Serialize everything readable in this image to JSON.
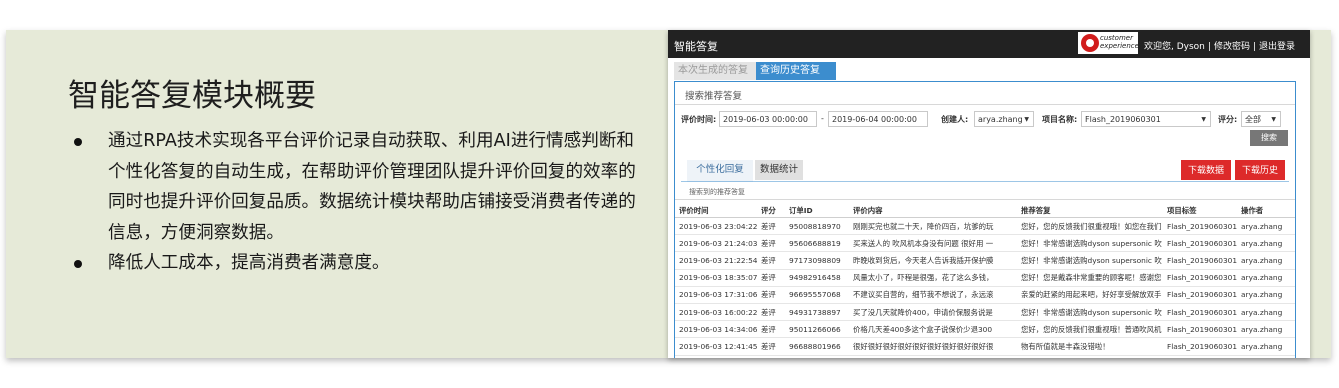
{
  "slide": {
    "title": "智能答复模块概要",
    "bullets": [
      "通过RPA技术实现各平台评价记录自动获取、利用AI进行情感判断和个性化答复的自动生成，在帮助评价管理团队提升评价回复的效率的同时也提升评价回复品质。数据统计模块帮助店铺接受消费者传递的信息，方便洞察数据。",
      "降低人工成本，提高消费者满意度。"
    ]
  },
  "app": {
    "name": "智能答复",
    "logo_line1": "customer",
    "logo_line2": "experience",
    "welcome": "欢迎您, Dyson",
    "change_password": "修改密码",
    "logout": "退出登录",
    "tabs": [
      "本次生成的答复",
      "查询历史答复"
    ],
    "active_tab": 1,
    "panel_title": "搜索推荐答复",
    "filters": {
      "time_label": "评价时间:",
      "time_start": "2019-06-03 00:00:00",
      "time_dash": "-",
      "time_end": "2019-06-04 00:00:00",
      "creator_label": "创建人:",
      "creator_value": "arya.zhang",
      "project_label": "项目名称:",
      "project_value": "Flash_2019060301",
      "rating_label": "评分:",
      "rating_value": "全部",
      "search_button": "搜索"
    },
    "subtabs": [
      "个性化回复",
      "数据统计"
    ],
    "download_data": "下载数据",
    "download_history": "下载历史",
    "result_caption": "搜索到的推荐答复",
    "table": {
      "columns": [
        "评价时间",
        "评分",
        "订单ID",
        "评价内容",
        "推荐答复",
        "项目标签",
        "操作者"
      ],
      "rows": [
        [
          "2019-06-03 23:04:22",
          "差评",
          "95008818970",
          "刚刚买完也就二十天，降价四百，坑爹的玩",
          "您好，您的反馈我们很重视哦！如您在我们",
          "Flash_2019060301",
          "arya.zhang"
        ],
        [
          "2019-06-03 21:24:03",
          "差评",
          "95606688819",
          "买来送人的 吹风机本身没有问题 很好用 一",
          "您好！非常感谢选购dyson supersonic 吹",
          "Flash_2019060301",
          "arya.zhang"
        ],
        [
          "2019-06-03 21:22:54",
          "差评",
          "97173098809",
          "昨晚收到货后，今天老人告诉我插开保护膜",
          "您好！非常感谢选购dyson supersonic 吹",
          "Flash_2019060301",
          "arya.zhang"
        ],
        [
          "2019-06-03 18:35:07",
          "差评",
          "94982916458",
          "风量太小了，吓程是很强，花了这么多钱，",
          "您好！您是戴森非常重要的顾客呢！感谢您",
          "Flash_2019060301",
          "arya.zhang"
        ],
        [
          "2019-06-03 17:31:06",
          "差评",
          "96695557068",
          "不建议买自营的，细节我不想说了，永远滚",
          "亲爱的赶紧的用起来吧，好好享受解放双手",
          "Flash_2019060301",
          "arya.zhang"
        ],
        [
          "2019-06-03 16:00:22",
          "差评",
          "94931738897",
          "买了没几天就降价400，申请价保服务说是",
          "您好！非常感谢选购dyson supersonic 吹",
          "Flash_2019060301",
          "arya.zhang"
        ],
        [
          "2019-06-03 14:34:06",
          "差评",
          "95011266066",
          "价格几天差400多这个盒子说保价少退300",
          "您好，您的反馈我们很重视哦！普通吹风机",
          "Flash_2019060301",
          "arya.zhang"
        ],
        [
          "2019-06-03 12:41:45",
          "差评",
          "96688801966",
          "很好很好很好很好很好很好很好很好很好很",
          "物有所值就是丰森没错啦！",
          "Flash_2019060301",
          "arya.zhang"
        ]
      ]
    }
  }
}
